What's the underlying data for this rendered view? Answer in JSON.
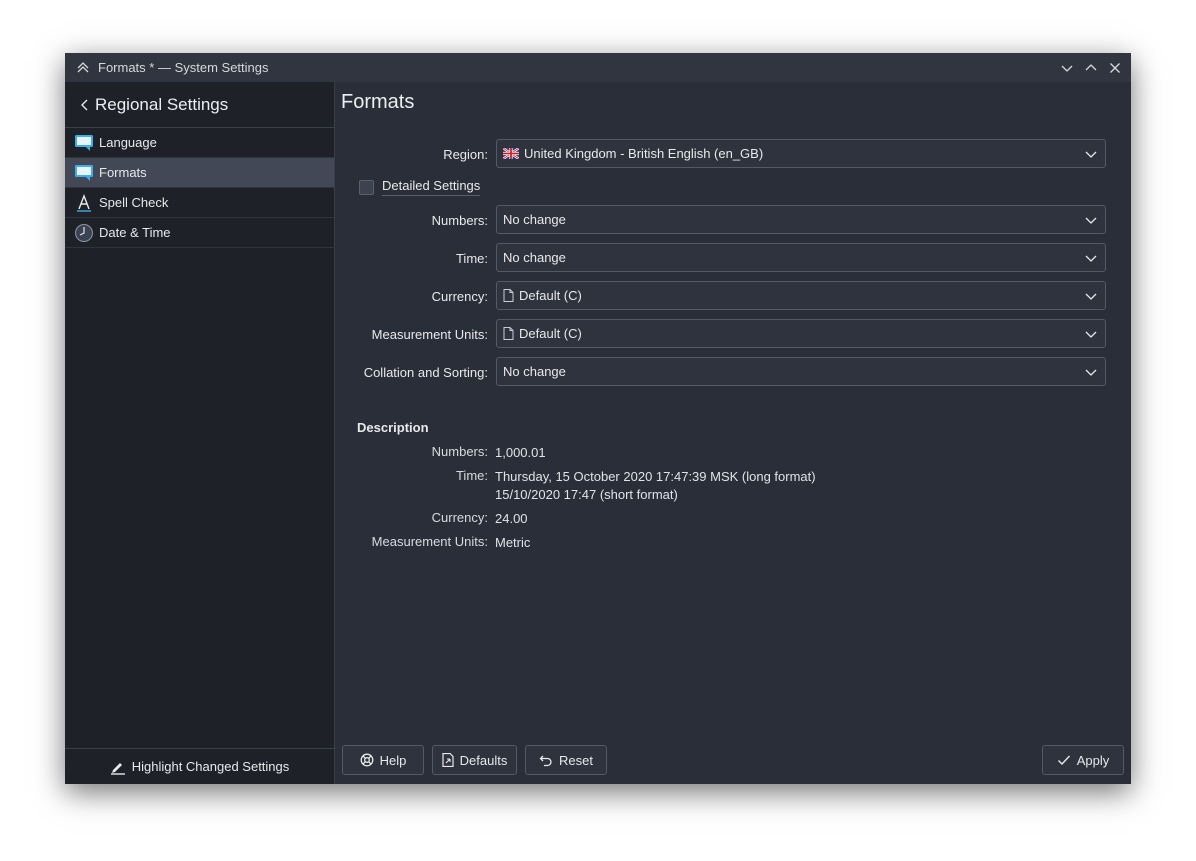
{
  "window": {
    "title": "Formats * — System Settings"
  },
  "sidebar": {
    "title": "Regional Settings",
    "items": [
      {
        "label": "Language",
        "icon": "language-icon",
        "selected": false
      },
      {
        "label": "Formats",
        "icon": "formats-icon",
        "selected": true
      },
      {
        "label": "Spell Check",
        "icon": "spell-check-icon",
        "selected": false
      },
      {
        "label": "Date & Time",
        "icon": "clock-icon",
        "selected": false
      }
    ],
    "footer_label": "Highlight Changed Settings"
  },
  "page": {
    "title": "Formats"
  },
  "form": {
    "region": {
      "label": "Region:",
      "value": "United Kingdom - British English (en_GB)"
    },
    "detailed_settings": {
      "label": "Detailed Settings",
      "checked": false
    },
    "numbers": {
      "label": "Numbers:",
      "value": "No change"
    },
    "time": {
      "label": "Time:",
      "value": "No change"
    },
    "currency": {
      "label": "Currency:",
      "value": "Default (C)"
    },
    "measurement": {
      "label": "Measurement Units:",
      "value": "Default (C)"
    },
    "collation": {
      "label": "Collation and Sorting:",
      "value": "No change"
    }
  },
  "description": {
    "title": "Description",
    "numbers": {
      "label": "Numbers:",
      "value": "1,000.01"
    },
    "time": {
      "label": "Time:",
      "long": "Thursday, 15 October 2020 17:47:39 MSK (long format)",
      "short": "15/10/2020 17:47 (short format)"
    },
    "currency": {
      "label": "Currency:",
      "value": "24.00"
    },
    "measurement": {
      "label": "Measurement Units:",
      "value": "Metric"
    }
  },
  "buttons": {
    "help": "Help",
    "defaults": "Defaults",
    "reset": "Reset",
    "apply": "Apply"
  },
  "colors": {
    "window_bg": "#2a2e38",
    "sidebar_bg": "#1f2129",
    "selected_bg": "#434857",
    "accent": "#3daee9"
  }
}
